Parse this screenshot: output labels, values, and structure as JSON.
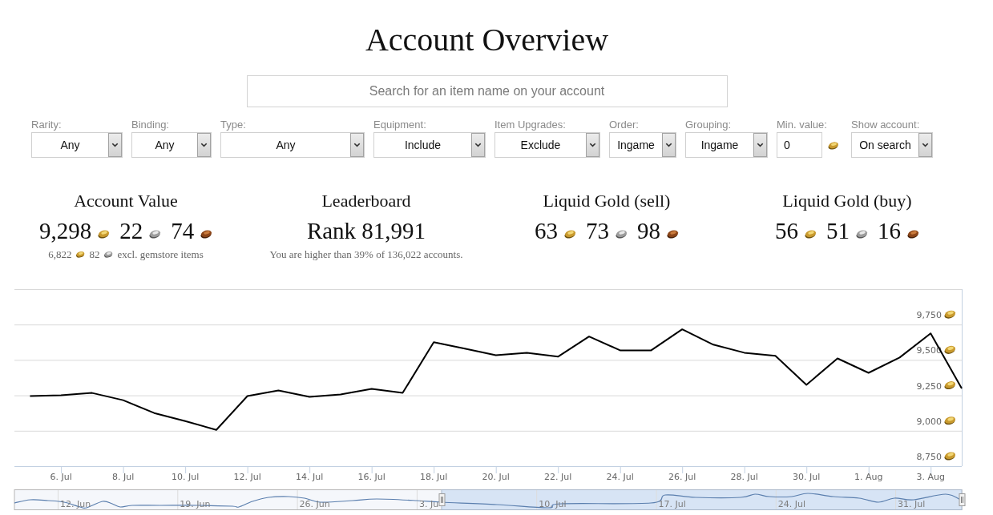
{
  "page": {
    "title": "Account Overview"
  },
  "search": {
    "placeholder": "Search for an item name on your account"
  },
  "filters": [
    {
      "label": "Rarity:",
      "kind": "select",
      "value": "Any"
    },
    {
      "label": "Binding:",
      "kind": "select",
      "value": "Any"
    },
    {
      "label": "Type:",
      "kind": "select",
      "value": "Any"
    },
    {
      "label": "Equipment:",
      "kind": "select",
      "value": "Include"
    },
    {
      "label": "Item Upgrades:",
      "kind": "select",
      "value": "Exclude"
    },
    {
      "label": "Order:",
      "kind": "select",
      "value": "Ingame"
    },
    {
      "label": "Grouping:",
      "kind": "select",
      "value": "Ingame"
    },
    {
      "label": "Min. value:",
      "kind": "amount",
      "value": "0"
    },
    {
      "label": "Show account:",
      "kind": "select",
      "value": "On search"
    }
  ],
  "stats": [
    {
      "title": "Account Value",
      "kind": "money",
      "amount": [
        {
          "value": "9,298",
          "kind": "gold"
        },
        {
          "value": "22",
          "kind": "silver"
        },
        {
          "value": "74",
          "kind": "copper"
        }
      ],
      "note": {
        "amount": [
          {
            "value": "6,822",
            "kind": "gold"
          },
          {
            "value": "82",
            "kind": "silver"
          }
        ],
        "text": "excl. gemstore items"
      }
    },
    {
      "title": "Leaderboard",
      "kind": "rank",
      "value": "Rank 81,991",
      "note": {
        "text": "You are higher than 39% of 136,022 accounts."
      }
    },
    {
      "title": "Liquid Gold (sell)",
      "kind": "money",
      "amount": [
        {
          "value": "63",
          "kind": "gold"
        },
        {
          "value": "73",
          "kind": "silver"
        },
        {
          "value": "98",
          "kind": "copper"
        }
      ]
    },
    {
      "title": "Liquid Gold (buy)",
      "kind": "money",
      "amount": [
        {
          "value": "56",
          "kind": "gold"
        },
        {
          "value": "51",
          "kind": "silver"
        },
        {
          "value": "16",
          "kind": "copper"
        }
      ]
    }
  ],
  "history_chart": {
    "chart_data": {
      "type": "line",
      "categories": [
        null,
        "6. Jul",
        null,
        "8. Jul",
        null,
        "10. Jul",
        null,
        "12. Jul",
        null,
        "14. Jul",
        null,
        "16. Jul",
        null,
        "18. Jul",
        null,
        "20. Jul",
        null,
        "22. Jul",
        null,
        "24. Jul",
        null,
        "26. Jul",
        null,
        "28. Jul",
        null,
        "30. Jul",
        null,
        "1. Aug",
        null,
        "3. Aug",
        null
      ],
      "series": [
        {
          "color": "#000000",
          "values": [
            9245,
            9250,
            9267,
            9216,
            9125,
            9068,
            9006,
            9245,
            9284,
            9239,
            9256,
            9296,
            9267,
            9625,
            9580,
            9534,
            9551,
            9523,
            9665,
            9568,
            9568,
            9716,
            9608,
            9551,
            9529,
            9324,
            9511,
            9409,
            9517,
            9688,
            9298
          ]
        }
      ],
      "ylim": [
        8750,
        10000
      ],
      "yticks": [
        {
          "value": 8750,
          "label": "8,750"
        },
        {
          "value": 9000,
          "label": "9,000"
        },
        {
          "value": 9250,
          "label": "9,250"
        },
        {
          "value": 9500,
          "label": "9,500"
        },
        {
          "value": 9750,
          "label": "9,750"
        }
      ],
      "grid": true
    },
    "navigator": {
      "labels": [
        "12. Jun",
        "19. Jun",
        "26. Jun",
        "3. Ju",
        "10. Jul",
        "17. Jul",
        "24. Jul",
        "31. Jul"
      ]
    }
  }
}
